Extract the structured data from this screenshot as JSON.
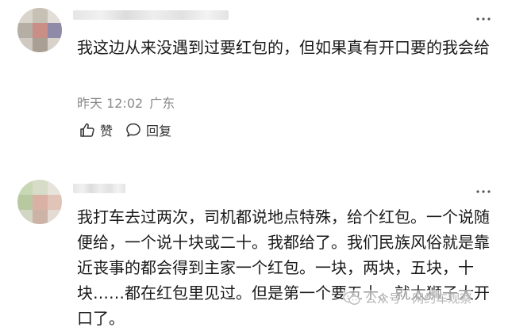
{
  "comments": [
    {
      "text": "我这边从来没遇到过要红包的，但如果真有开口要的我会给",
      "time": "昨天 12:02",
      "location": "广东",
      "like_label": "赞",
      "reply_label": "回复"
    },
    {
      "text": "我打车去过两次，司机都说地点特殊，给个红包。一个说随便给，一个说十块或二十。我都给了。我们民族风俗就是靠近丧事的都会得到主家一个红包。一块，两块，五块，十块……都在红包里见过。但是第一个要五十。就太狮子大开口了。"
    }
  ],
  "watermark": {
    "text": "公众号 · 网约车观察"
  },
  "icons": {
    "more": "more-dots-icon",
    "like": "thumb-up-icon",
    "reply": "speech-bubble-icon",
    "watermark": "wechat-icon"
  }
}
